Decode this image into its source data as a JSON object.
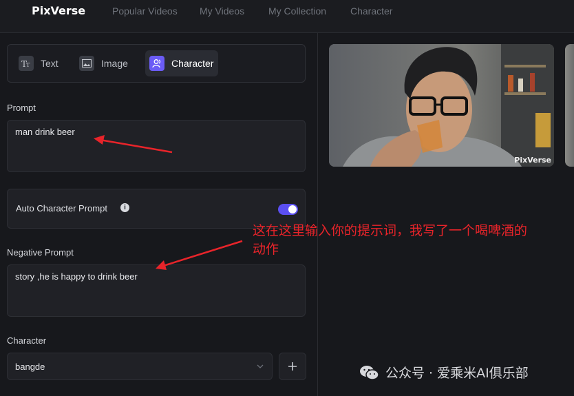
{
  "app": {
    "logo": "PixVerse"
  },
  "nav": {
    "items": [
      "Popular Videos",
      "My Videos",
      "My Collection",
      "Character"
    ]
  },
  "modes": [
    {
      "label": "Text",
      "icon": "text-icon"
    },
    {
      "label": "Image",
      "icon": "image-icon"
    },
    {
      "label": "Character",
      "icon": "character-icon",
      "active": true
    }
  ],
  "prompt": {
    "label": "Prompt",
    "value": "man drink beer"
  },
  "auto_character": {
    "label": "Auto Character Prompt",
    "enabled": true,
    "info_icon": "info-icon"
  },
  "negative_prompt": {
    "label": "Negative Prompt",
    "value": "story ,he is happy to drink beer"
  },
  "character": {
    "label": "Character",
    "selected": "bangde"
  },
  "preview": {
    "watermark": "PixVerse"
  },
  "annotation": {
    "line1": "这在这里输入你的提示词，我写了一个喝啤酒的",
    "line2": "动作"
  },
  "watermark": {
    "text": "公众号 · 爱乘米AI俱乐部"
  },
  "colors": {
    "accent": "#5b4ff2",
    "annotation": "#e8242a"
  }
}
